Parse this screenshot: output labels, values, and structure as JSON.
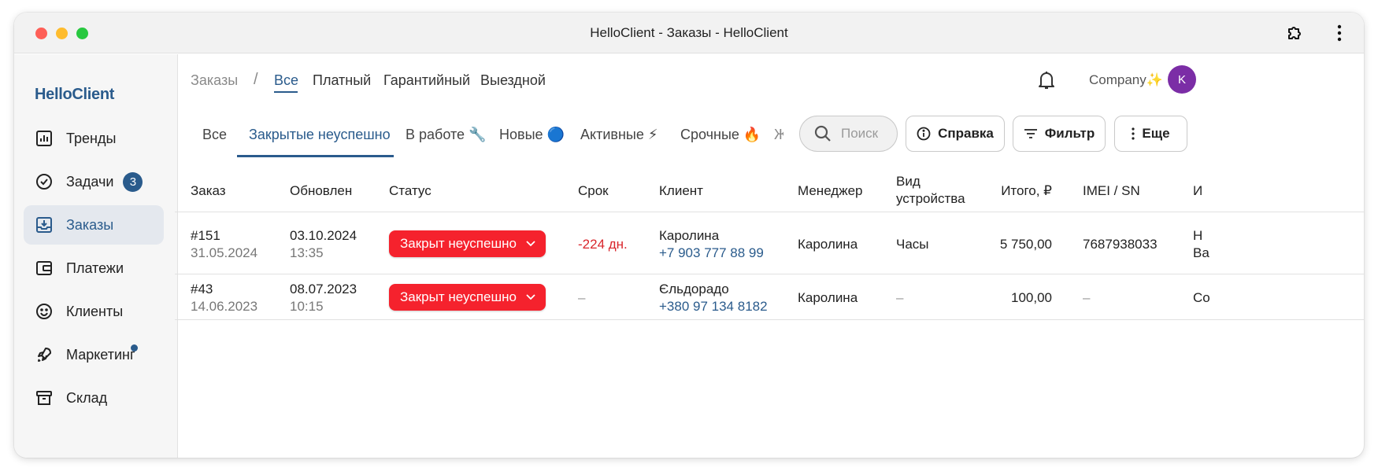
{
  "window": {
    "title": "HelloClient - Заказы - HelloClient"
  },
  "sidebar": {
    "brand": "HelloClient",
    "items": [
      {
        "label": "Тренды",
        "icon": "chart-icon"
      },
      {
        "label": "Задачи",
        "icon": "check-circle-icon",
        "badge": "3"
      },
      {
        "label": "Заказы",
        "icon": "inbox-download-icon",
        "active": true
      },
      {
        "label": "Платежи",
        "icon": "wallet-icon"
      },
      {
        "label": "Клиенты",
        "icon": "smile-icon"
      },
      {
        "label": "Маркетинг",
        "icon": "rocket-icon",
        "dot": true
      },
      {
        "label": "Склад",
        "icon": "archive-icon"
      }
    ]
  },
  "header": {
    "breadcrumb_root": "Заказы",
    "breadcrumb_sep": "/",
    "tabs": [
      "Все",
      "Платный",
      "Гарантийный",
      "Выездной"
    ],
    "company": "Company✨",
    "avatar_initial": "K"
  },
  "filters": {
    "tabs": [
      "Все",
      "Закрытые неуспешно",
      "В работе 🔧",
      "Новые 🔵",
      "Активные ⚡",
      "Срочные 🔥",
      "Ж"
    ],
    "active_index": 1,
    "search_placeholder": "Поиск",
    "help_label": "Справка",
    "filter_label": "Фильтр",
    "more_label": "Еще"
  },
  "table": {
    "columns": [
      "Заказ",
      "Обновлен",
      "Статус",
      "Срок",
      "Клиент",
      "Менеджер",
      "Вид устройства",
      "Итого, ₽",
      "IMEI / SN",
      "И"
    ],
    "rows": [
      {
        "order": "#151",
        "order_date": "31.05.2024",
        "updated_date": "03.10.2024",
        "updated_time": "13:35",
        "status": "Закрыт неуспешно",
        "deadline": "-224 дн.",
        "client_name": "Каролина",
        "client_phone": "+7 903 777 88 99",
        "manager": "Каролина",
        "device": "Часы",
        "total": "5 750,00",
        "imei": "7687938033",
        "extra": "Н\nВа"
      },
      {
        "order": "#43",
        "order_date": "14.06.2023",
        "updated_date": "08.07.2023",
        "updated_time": "10:15",
        "status": "Закрыт неуспешно",
        "deadline": "–",
        "client_name": "Єльдорадо",
        "client_phone": "+380 97 134 8182",
        "manager": "Каролина",
        "device": "–",
        "total": "100,00",
        "imei": "–",
        "extra": "Co"
      }
    ]
  },
  "colors": {
    "accent": "#2a5b8c",
    "status_red": "#f5222d",
    "avatar": "#7b2da6"
  }
}
